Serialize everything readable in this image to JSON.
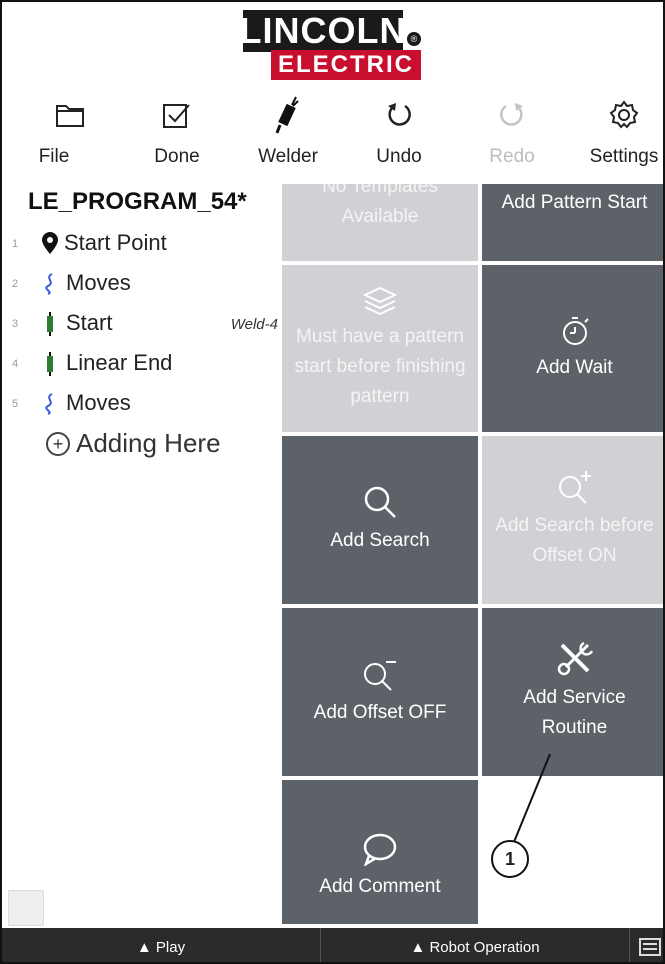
{
  "logo": {
    "top": "LINCOLN",
    "bottom": "ELECTRIC",
    "mark": "®"
  },
  "toolbar": {
    "file": {
      "label": "File",
      "icon": "folder-icon"
    },
    "done": {
      "label": "Done",
      "icon": "checkbox-icon"
    },
    "welder": {
      "label": "Welder",
      "icon": "welding-torch-icon"
    },
    "undo": {
      "label": "Undo",
      "icon": "undo-icon"
    },
    "redo": {
      "label": "Redo",
      "icon": "redo-icon",
      "disabled": true
    },
    "settings": {
      "label": "Settings",
      "icon": "gear-icon"
    }
  },
  "program": {
    "title": "LE_PROGRAM_54*",
    "items": [
      {
        "num": "1",
        "label": "Start Point",
        "icon": "location-pin-icon",
        "weld": ""
      },
      {
        "num": "2",
        "label": "Moves",
        "icon": "moves-path-icon",
        "weld": ""
      },
      {
        "num": "3",
        "label": "Start",
        "icon": "weld-start-icon",
        "weld": "Weld-4"
      },
      {
        "num": "4",
        "label": "Linear End",
        "icon": "weld-end-icon",
        "weld": ""
      },
      {
        "num": "5",
        "label": "Moves",
        "icon": "moves-path-icon",
        "weld": ""
      }
    ],
    "adding": "Adding Here"
  },
  "tiles": {
    "no_templates": "No Templates Available",
    "add_pattern_start": "Add Pattern Start",
    "must_have_pattern": "Must have a pattern start before finishing pattern",
    "add_wait": "Add Wait",
    "add_search": "Add Search",
    "add_search_before_offset": "Add Search before Offset ON",
    "add_offset_off": "Add Offset OFF",
    "add_service_routine": "Add Service Routine",
    "add_comment": "Add Comment"
  },
  "callout": "1",
  "bottom": {
    "play": "▲ Play",
    "robot_operation": "▲ Robot Operation"
  },
  "colors": {
    "tile_dark": "#5d6168",
    "tile_light": "#cfd1d4",
    "accent_red": "#c8102e",
    "moves_blue": "#3b5bdb",
    "weld_green": "#2e7d32"
  }
}
